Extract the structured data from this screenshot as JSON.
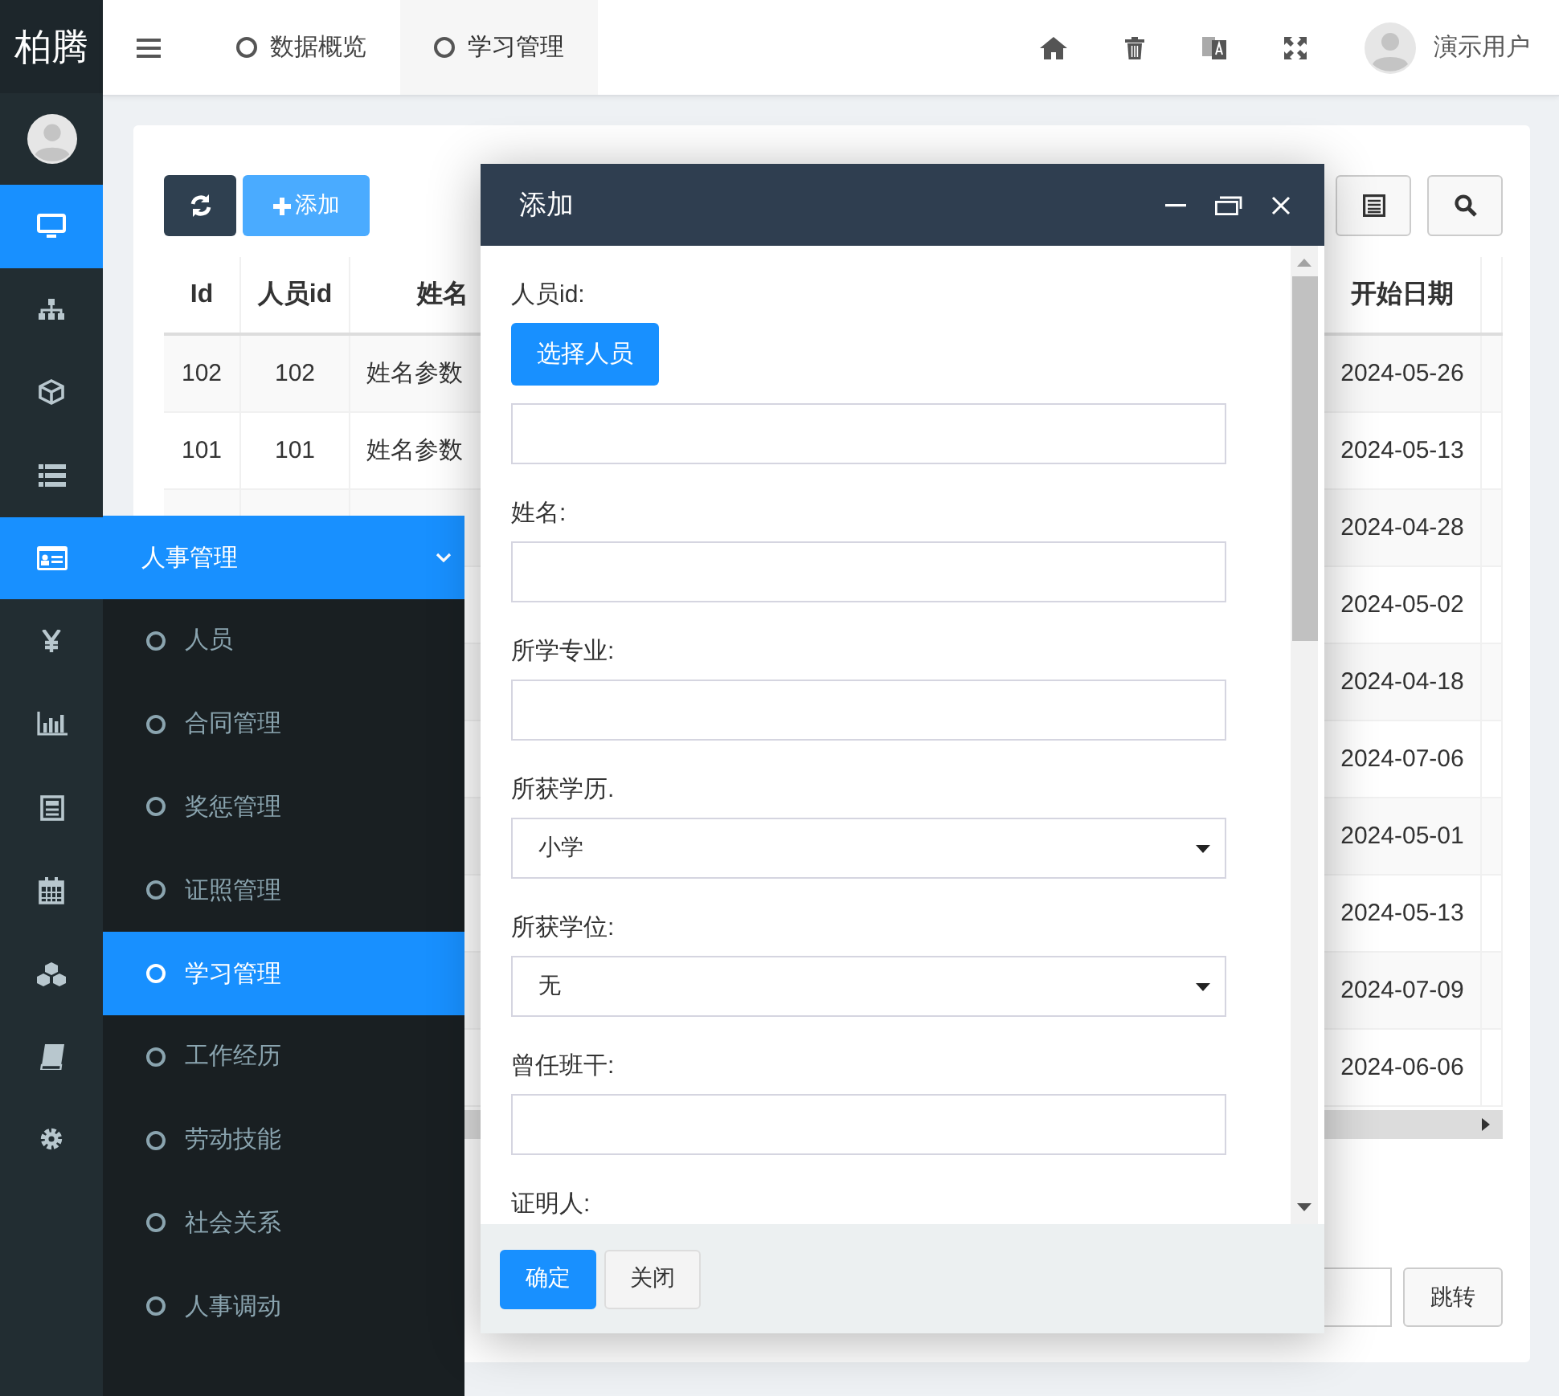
{
  "logo": "柏腾",
  "rail": [
    {
      "kind": "desktop",
      "selected": true
    },
    {
      "kind": "sitemap",
      "selected": false
    },
    {
      "kind": "cube",
      "selected": false
    },
    {
      "kind": "list",
      "selected": false
    },
    {
      "kind": "idcard",
      "selected": true
    },
    {
      "kind": "yen",
      "selected": false
    },
    {
      "kind": "chart",
      "selected": false
    },
    {
      "kind": "calculator",
      "selected": false
    },
    {
      "kind": "calendar",
      "selected": false
    },
    {
      "kind": "cubes",
      "selected": false
    },
    {
      "kind": "book",
      "selected": false
    },
    {
      "kind": "gear",
      "selected": false
    }
  ],
  "header": {
    "tabs": [
      {
        "label": "数据概览",
        "selected": false
      },
      {
        "label": "学习管理",
        "selected": true
      }
    ],
    "user": "演示用户"
  },
  "toolbar": {
    "add_label": "添加"
  },
  "table": {
    "columns": [
      "Id",
      "人员id",
      "姓名",
      "开始日期"
    ],
    "rows": [
      {
        "id": "102",
        "person_id": "102",
        "name": "姓名参数",
        "start_date": "2024-05-26"
      },
      {
        "id": "101",
        "person_id": "101",
        "name": "姓名参数",
        "start_date": "2024-05-13"
      },
      {
        "start_date": "2024-04-28"
      },
      {
        "start_date": "2024-05-02"
      },
      {
        "start_date": "2024-04-18"
      },
      {
        "start_date": "2024-07-06"
      },
      {
        "start_date": "2024-05-01"
      },
      {
        "start_date": "2024-05-13"
      },
      {
        "start_date": "2024-07-09"
      },
      {
        "start_date": "2024-06-06"
      }
    ]
  },
  "pagination": {
    "jump_label": "跳转"
  },
  "flyout": {
    "title": "人事管理",
    "expanded": true,
    "items": [
      {
        "label": "人员",
        "selected": false
      },
      {
        "label": "合同管理",
        "selected": false
      },
      {
        "label": "奖惩管理",
        "selected": false
      },
      {
        "label": "证照管理",
        "selected": false
      },
      {
        "label": "学习管理",
        "selected": true
      },
      {
        "label": "工作经历",
        "selected": false
      },
      {
        "label": "劳动技能",
        "selected": false
      },
      {
        "label": "社会关系",
        "selected": false
      },
      {
        "label": "人事调动",
        "selected": false
      }
    ]
  },
  "modal": {
    "title": "添加",
    "fields": [
      {
        "kind": "picker",
        "label": "人员id:",
        "button": "选择人员"
      },
      {
        "kind": "text",
        "label": "姓名:"
      },
      {
        "kind": "text",
        "label": "所学专业:"
      },
      {
        "kind": "select",
        "label": "所获学历.",
        "value": "小学"
      },
      {
        "kind": "select",
        "label": "所获学位:",
        "value": "无"
      },
      {
        "kind": "text",
        "label": "曾任班干:"
      },
      {
        "kind": "text",
        "label": "证明人:"
      }
    ],
    "buttons": [
      {
        "label": "确定",
        "kind": "primary"
      },
      {
        "label": "关闭",
        "kind": "default"
      }
    ]
  }
}
